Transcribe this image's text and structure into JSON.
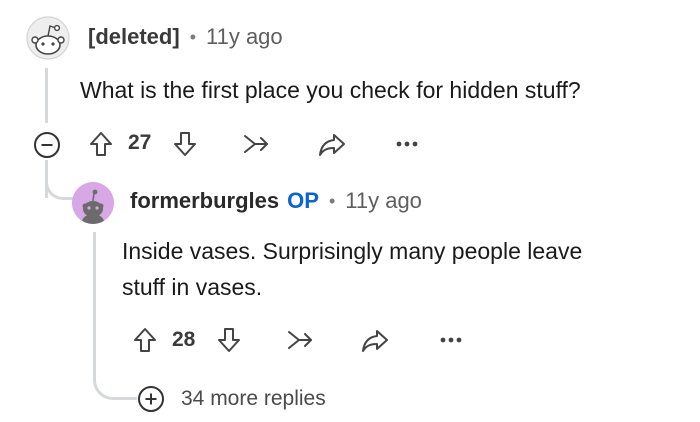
{
  "comment": {
    "author": "[deleted]",
    "time": "11y ago",
    "body": "What is the first place you check for hidden stuff?",
    "votes": "27"
  },
  "reply": {
    "author": "formerburgles",
    "op_badge": "OP",
    "time": "11y ago",
    "body_line1": "Inside vases. Surprisingly many people leave",
    "body_line2": "stuff in vases.",
    "votes": "28"
  },
  "more_replies": "34 more replies",
  "separator": "•",
  "colors": {
    "op": "#0a63d0",
    "avatar_bg": "#d7a7e6",
    "thread_line": "#d5d9db"
  }
}
